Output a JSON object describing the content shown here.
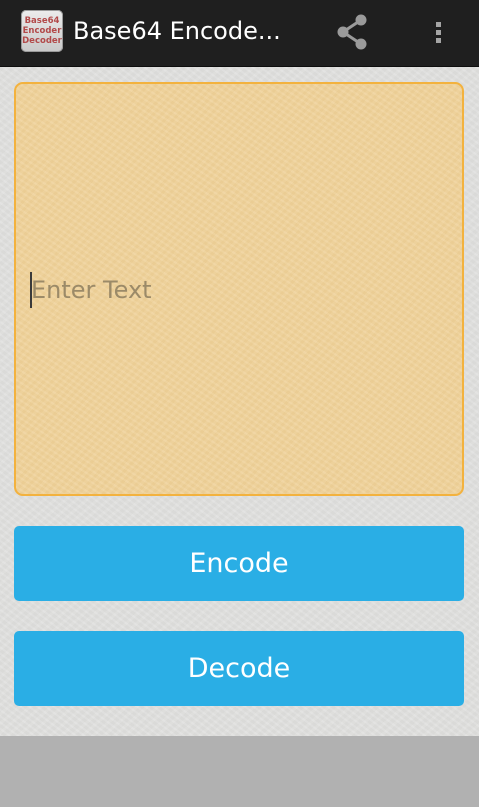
{
  "action_bar": {
    "app_icon_lines": [
      "Base64",
      "Encoder",
      "Decoder"
    ],
    "title": "Base64 Encode...",
    "share_icon": "share-icon",
    "overflow_icon": "overflow-menu-icon",
    "background_color": "#1f1f1f"
  },
  "input": {
    "placeholder": "Enter Text",
    "value": "",
    "background_color": "#efd29a",
    "border_color": "#f3b23e"
  },
  "buttons": {
    "encode_label": "Encode",
    "decode_label": "Decode",
    "color": "#2aaee5"
  }
}
